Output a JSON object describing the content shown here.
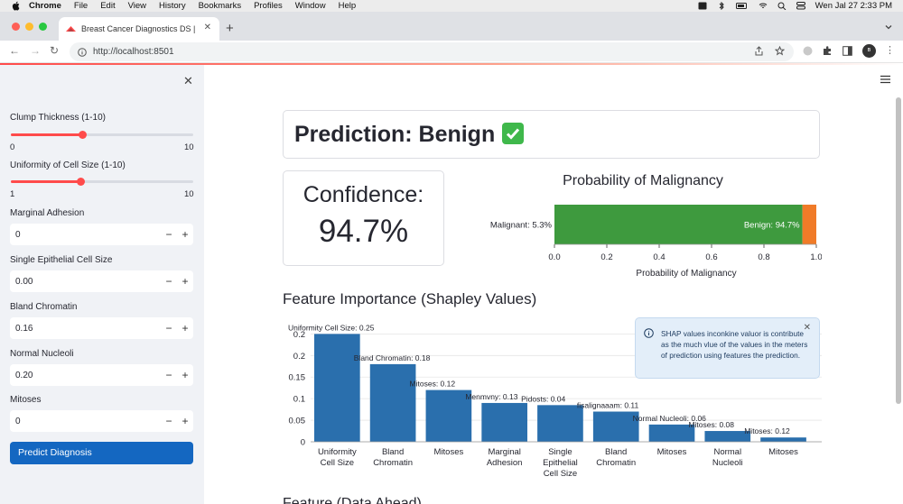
{
  "menubar": {
    "app": "Chrome",
    "items": [
      "File",
      "Edit",
      "View",
      "History",
      "Bookmarks",
      "Profiles",
      "Window",
      "Help"
    ],
    "datetime": "Wen Jal 27  2:33 PM"
  },
  "browser": {
    "tab_title": "Breast Cancer Diagnostics DS |",
    "url": "http://localhost:8501"
  },
  "sidebar": {
    "sliders": [
      {
        "label": "Clump Thickness (1-10)",
        "min": "0",
        "max": "10",
        "value_fraction": 0.39
      },
      {
        "label": "Uniformity of Cell Size (1-10)",
        "min": "1",
        "max": "10",
        "value_fraction": 0.38
      }
    ],
    "inputs": [
      {
        "label": "Marginal Adhesion",
        "value": "0"
      },
      {
        "label": "Single Epithelial Cell Size",
        "value": "0.00"
      },
      {
        "label": "Bland Chromatin",
        "value": "0.16"
      },
      {
        "label": "Normal Nucleoli",
        "value": "0.20"
      },
      {
        "label": "Mitoses",
        "value": "0"
      }
    ],
    "stepper_minus": "−",
    "stepper_plus": "+",
    "predict_label": "Predict Diagnosis"
  },
  "main": {
    "prediction_title": "Prediction: Benign",
    "confidence_label": "Confidence:",
    "confidence_value": "94.7%",
    "shap_title": "Feature Importance (Shapley Values)",
    "toast_text": "SHAP values inconkine valuor is contribute as the much vlue of the values in the meters of prediction using features the prediction.",
    "bottom_heading_partial": "Feature (Data Ahead)"
  },
  "chart_data": [
    {
      "type": "bar",
      "orientation": "horizontal-stacked",
      "title": "Probability of Malignancy",
      "xlabel": "Probability of Malignancy",
      "xlim": [
        0,
        1.0
      ],
      "xticks": [
        "0.0",
        "0.2",
        "0.4",
        "0.6",
        "0.8",
        "1.0"
      ],
      "series": [
        {
          "label": "Benign: 94.7%",
          "value": 0.947,
          "color": "#3e9a3e"
        },
        {
          "label": "Malignant: 5.3%",
          "value": 0.053,
          "color": "#f07b28"
        }
      ]
    },
    {
      "type": "bar",
      "ylim": [
        0,
        0.25
      ],
      "yticks": [
        "0",
        "0.05",
        "0.1",
        "0.15",
        "0.2",
        "0.2"
      ],
      "color": "#2a6fad",
      "categories": [
        "Uniformity\nCell Size",
        "Bland\nChromatin",
        "Mitoses",
        "Marginal\nAdhesion",
        "Single\nEpithelial\nCell Size",
        "Bland\nChromatin",
        "Mitoses",
        "Normal\nNucleoli",
        "Mitoses"
      ],
      "values": [
        0.25,
        0.18,
        0.12,
        0.09,
        0.085,
        0.07,
        0.04,
        0.025,
        0.01
      ],
      "bar_labels": [
        "Uniformity Cell Size: 0.25",
        "Bland Chromatin: 0.18",
        "Mitoses: 0.12",
        "Menmvny: 0.13",
        "Pidosts: 0.04",
        "fisalignaaam: 0.11",
        "Normal Nucleoli: 0.06",
        "Mitoses: 0.08",
        "Mitoses: 0.12"
      ]
    }
  ]
}
